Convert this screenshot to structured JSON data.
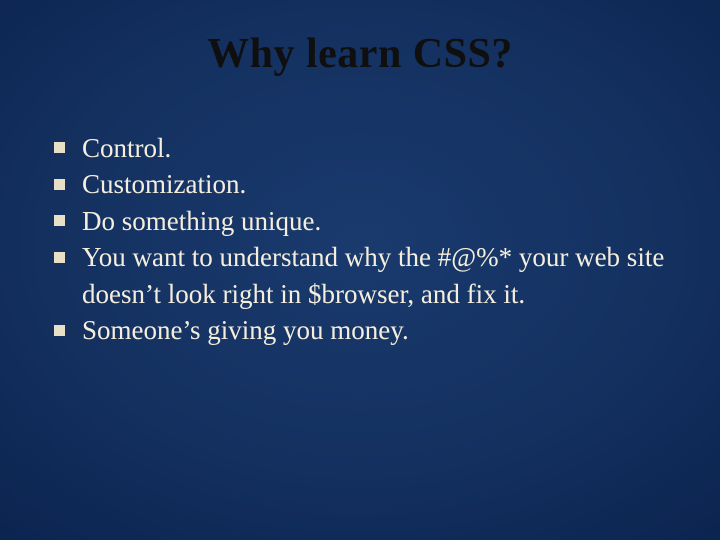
{
  "slide": {
    "title": "Why learn CSS?",
    "bullets": [
      "Control.",
      "Customization.",
      "Do something unique.",
      "You want to understand why the #@%* your web site doesn’t look right in $browser, and fix it.",
      "Someone’s giving you money."
    ]
  }
}
